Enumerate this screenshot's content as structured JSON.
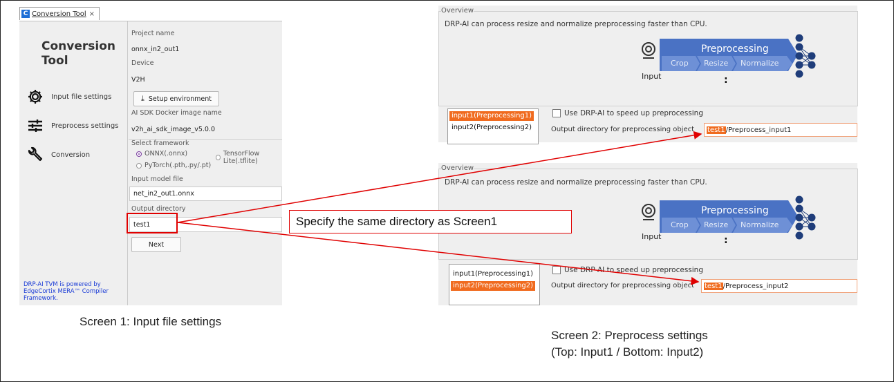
{
  "screen1": {
    "tab_icon": "C",
    "tab_title": "Conversion Tool",
    "tab_close": "×",
    "app_title_line1": "Conversion",
    "app_title_line2": "Tool",
    "sidebar": [
      {
        "label": "Input file settings",
        "icon": "gear-icon"
      },
      {
        "label": "Preprocess settings",
        "icon": "sliders-icon"
      },
      {
        "label": "Conversion",
        "icon": "wrench-icon"
      }
    ],
    "powered_by": "DRP-AI TVM is powered by EdgeCortix MERA™ Compiler Framework.",
    "form": {
      "project_name_label": "Project name",
      "project_name_value": "onnx_in2_out1",
      "device_label": "Device",
      "device_value": "V2H",
      "setup_button": "Setup environment",
      "docker_label": "AI SDK Docker image name",
      "docker_value": "v2h_ai_sdk_image_v5.0.0",
      "framework_label": "Select framework",
      "framework_options": [
        "ONNX(.onnx)",
        "TensorFlow Lite(.tflite)",
        "PyTorch(.pth,.py/.pt)"
      ],
      "framework_selected": "ONNX(.onnx)",
      "model_label": "Input model file",
      "model_value": "net_in2_out1.onnx",
      "output_label": "Output directory",
      "output_value": "test1",
      "next_button": "Next"
    },
    "caption": "Screen 1: Input file settings"
  },
  "callout": "Specify the same directory as Screen1",
  "screen2": {
    "overview_label": "Overview",
    "overview_desc": "DRP-AI can process resize and normalize preprocessing faster than CPU.",
    "diagram": {
      "title": "Preprocessing",
      "steps": [
        "Crop",
        "Resize",
        "Normalize"
      ],
      "input_label": "Input",
      "ellipsis": ":"
    },
    "checkbox_label": "Use DRP-AI to speed up preprocessing",
    "output_label": "Output directory for preprocessing object",
    "inputs": [
      "input1(Preprocessing1)",
      "input2(Preprocessing2)"
    ],
    "top": {
      "selected": 0,
      "dir": "test1",
      "suffix": "/Preprocess_input1"
    },
    "bottom": {
      "selected": 1,
      "dir": "test1",
      "suffix": "/Preprocess_input2"
    },
    "caption_line1": "Screen 2: Preprocess settings",
    "caption_line2": "(Top: Input1 / Bottom: Input2)"
  },
  "colors": {
    "accent_orange": "#f06b1f",
    "arrow_red": "#e00000",
    "diagram_blue": "#4a72c4",
    "nn_navy": "#1f3d7a"
  }
}
